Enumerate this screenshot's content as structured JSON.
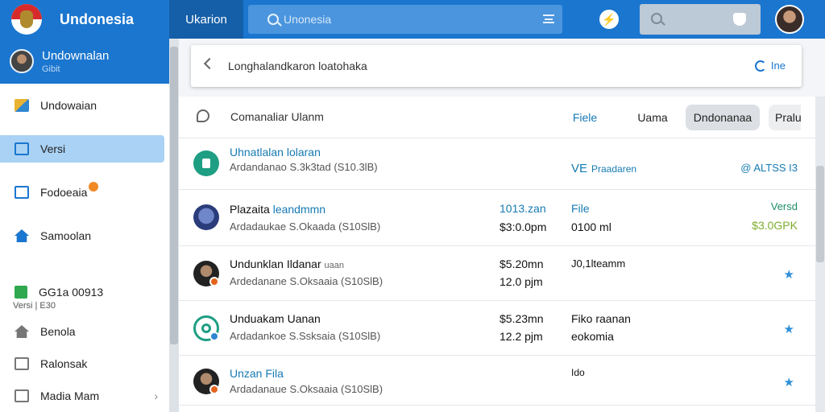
{
  "app": {
    "title": "Undonesia"
  },
  "topbar": {
    "active_tab": "Ukarion",
    "search_placeholder": "Unonesia"
  },
  "sidebar": {
    "profile": {
      "name": "Undownalan",
      "sub": "Gibit"
    },
    "items": [
      {
        "label": "Undowaian"
      },
      {
        "label": "Versi"
      },
      {
        "label": "Fodoeaia"
      },
      {
        "label": "Samoolan"
      },
      {
        "label": "GG1a 00913"
      },
      {
        "label": "Benola"
      },
      {
        "label": "Ralonsak"
      },
      {
        "label": "Madia Mam"
      }
    ],
    "caption": "Versi | E30"
  },
  "main": {
    "search_text": "Longhalandkaron loatohaka",
    "search_action": "Ine",
    "filter_label": "Comanaliar  Ulanm",
    "filters": [
      "Fiele",
      "Uama",
      "Dndonanaa",
      "Pralu"
    ],
    "rows": [
      {
        "name": "Uhnatlalan lolaran",
        "sub": "Ardandanao S.3k3tad (S10.3lB)",
        "c3": "VE",
        "c3b": "Praadaren",
        "c4": "@ ALTSS I3"
      },
      {
        "name": "Plazaita",
        "name_b": "leandmmn",
        "sub": "Ardadaukae S.Okaada (S10SlB)",
        "c2a": "1013.zan",
        "c2b": "$3:0.0pm",
        "c3": "File",
        "c3b": "0100 ml",
        "c4a": "Versd",
        "c4b": "$3.0GPK"
      },
      {
        "name": "Undunklan",
        "name_b": "Ildanar",
        "name_c": "uaan",
        "sub": "Ardedanane S.Oksaaia (S10SlB)",
        "c2a": "$5.20mn",
        "c2b": "12.0 pjm",
        "c3": "J0,1lteamm"
      },
      {
        "name": "Unduakam Uanan",
        "sub": "Ardadankoe S.Ssksaia (S10SlB)",
        "c2a": "$5.23mn",
        "c2b": "12.2 pjm",
        "c3": "Fiko raanan",
        "c3b": "eokomia"
      },
      {
        "name": "Unzan Fila",
        "sub": "Ardadanaue S.Oksaaia (S10SlB)",
        "c3": "Ido"
      }
    ]
  }
}
